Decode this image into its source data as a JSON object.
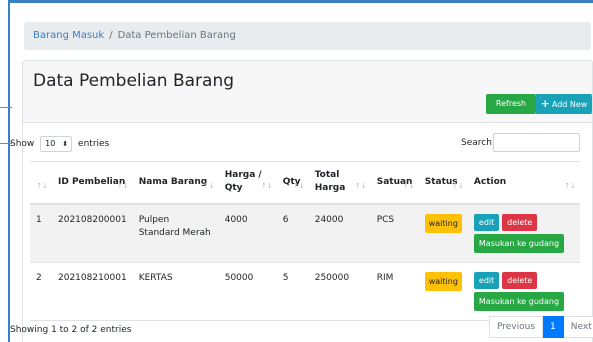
{
  "breadcrumb": {
    "parent": "Barang Masuk",
    "separator": "/",
    "current": "Data Pembelian Barang"
  },
  "page": {
    "title": "Data Pembelian Barang"
  },
  "toolbar": {
    "refresh_label": "Refresh",
    "add_label": "Add New"
  },
  "length": {
    "show_label": "Show",
    "value": "10",
    "entries_label": "entries"
  },
  "search": {
    "label": "Search:",
    "value": ""
  },
  "table": {
    "headers": [
      "",
      "ID Pembelian",
      "Nama Barang",
      "Harga / Qty",
      "Qty",
      "Total Harga",
      "Satuan",
      "Status",
      "Action"
    ],
    "rows": [
      {
        "no": "1",
        "id": "202108200001",
        "nama": "Pulpen Standard Merah",
        "harga": "4000",
        "qty": "6",
        "total": "24000",
        "satuan": "PCS",
        "status": "waiting"
      },
      {
        "no": "2",
        "id": "202108210001",
        "nama": "KERTAS",
        "harga": "50000",
        "qty": "5",
        "total": "250000",
        "satuan": "RIM",
        "status": "waiting"
      }
    ],
    "actions": {
      "edit": "edit",
      "delete": "delete",
      "gudang": "Masukan ke gudang"
    }
  },
  "footer": {
    "info": "Showing 1 to 2 of 2 entries",
    "previous": "Previous",
    "page": "1",
    "next": "Next"
  },
  "colors": {
    "primary": "#007bff",
    "success": "#28a745",
    "info": "#17a2b8",
    "danger": "#dc3545",
    "warning": "#ffc107"
  }
}
